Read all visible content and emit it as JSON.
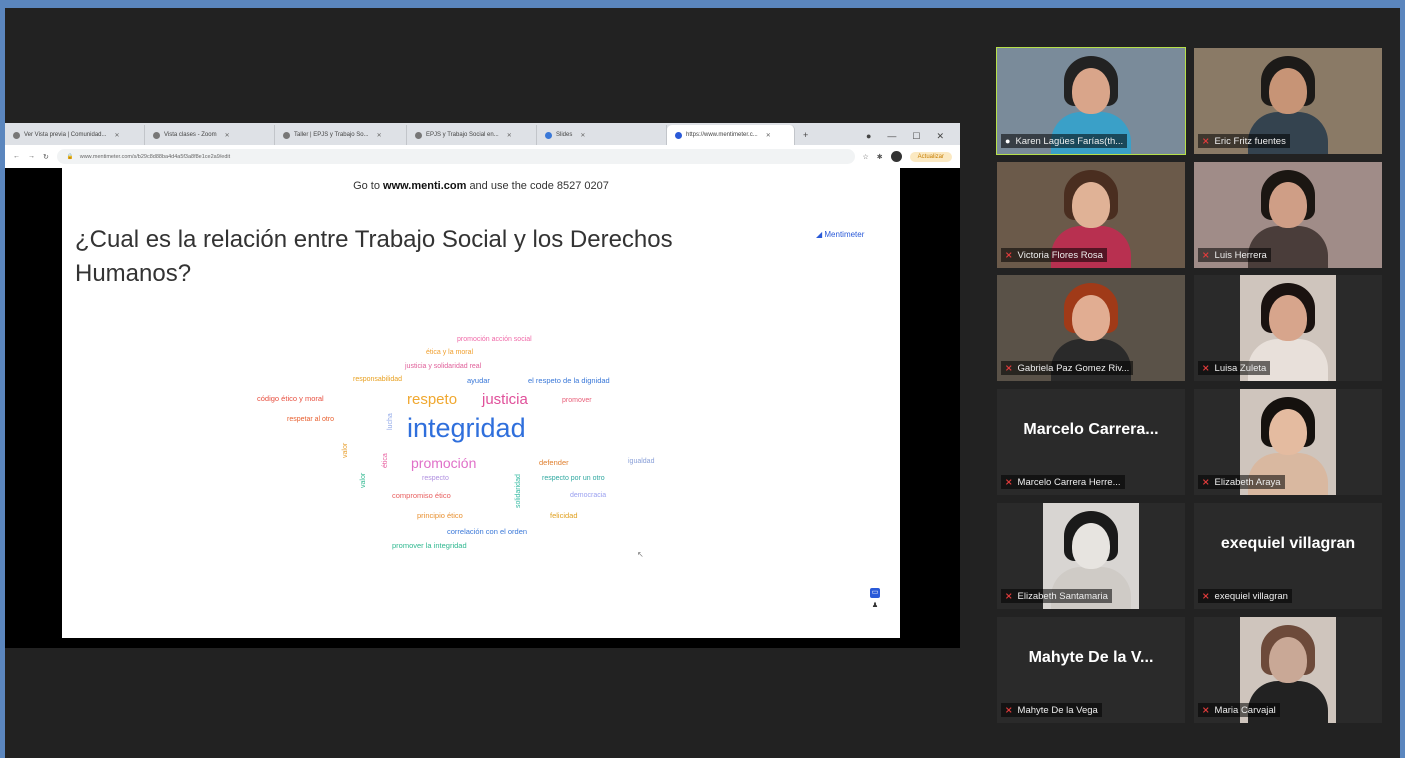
{
  "browser": {
    "tabs": [
      {
        "label": "Ver Vista previa | Comunidad..."
      },
      {
        "label": "Vista clases - Zoom"
      },
      {
        "label": "Taller | EPJS y Trabajo So..."
      },
      {
        "label": "EPJS y Trabajo Social en..."
      },
      {
        "label": "Slides"
      },
      {
        "label": "https://www.mentimeter.c..."
      }
    ],
    "url": "www.mentimeter.com/s/b29c8d88ba4d4a5f3a8f8e1ce2a9/edit",
    "update_label": "Actualizar"
  },
  "slide": {
    "goto_prefix": "Go to",
    "goto_site": "www.menti.com",
    "goto_middle": "and use the code",
    "goto_code": "8527 0207",
    "question": "¿Cual es la relación entre Trabajo Social y los Derechos Humanos?",
    "logo": "Mentimeter"
  },
  "wordcloud": [
    {
      "text": "promoción acción social",
      "color": "#f06aa8"
    },
    {
      "text": "ética y la moral",
      "color": "#f0a030"
    },
    {
      "text": "justicia y solidaridad real",
      "color": "#e0609a"
    },
    {
      "text": "responsabilidad",
      "color": "#e8a020"
    },
    {
      "text": "ayudar",
      "color": "#3a78d8"
    },
    {
      "text": "el respeto de la dignidad",
      "color": "#3a78d8"
    },
    {
      "text": "código ético y moral",
      "color": "#e85040"
    },
    {
      "text": "respeto",
      "color": "#f0a830"
    },
    {
      "text": "justicia",
      "color": "#e0509a"
    },
    {
      "text": "promover",
      "color": "#e8607a"
    },
    {
      "text": "respetar al otro",
      "color": "#e86030"
    },
    {
      "text": "integridad",
      "color": "#2f6fdc"
    },
    {
      "text": "promoción",
      "color": "#e070c8"
    },
    {
      "text": "defender",
      "color": "#e08030"
    },
    {
      "text": "igualdad",
      "color": "#8aa0d8"
    },
    {
      "text": "respecto",
      "color": "#b090e0"
    },
    {
      "text": "respecto por un otro",
      "color": "#30a8a0"
    },
    {
      "text": "compromiso ético",
      "color": "#e86060"
    },
    {
      "text": "democracia",
      "color": "#9aa0f0"
    },
    {
      "text": "principio ético",
      "color": "#e89030"
    },
    {
      "text": "felicidad",
      "color": "#e0a020"
    },
    {
      "text": "correlación con el orden",
      "color": "#3a78d8"
    },
    {
      "text": "promover la integridad",
      "color": "#30b890"
    },
    {
      "text": "lucha",
      "color": "#90a8e8"
    },
    {
      "text": "ética",
      "color": "#e860a0"
    },
    {
      "text": "valor",
      "color": "#30b890"
    },
    {
      "text": "valor",
      "color": "#e8a030"
    },
    {
      "text": "solidaridad",
      "color": "#30b8a0"
    }
  ],
  "participants": [
    {
      "name": "Karen Lagües Farías(th...",
      "mic": "on",
      "display": ""
    },
    {
      "name": "Eric Fritz fuentes",
      "mic": "off",
      "display": ""
    },
    {
      "name": "Victoria Flores Rosa",
      "mic": "off",
      "display": ""
    },
    {
      "name": "Luis Herrera",
      "mic": "off",
      "display": ""
    },
    {
      "name": "Gabriela Paz Gomez Riv...",
      "mic": "off",
      "display": ""
    },
    {
      "name": "Luisa Zuleta",
      "mic": "off",
      "display": ""
    },
    {
      "name": "Marcelo Carrera Herre...",
      "mic": "off",
      "display": "Marcelo  Carrera..."
    },
    {
      "name": "Elizabeth Araya",
      "mic": "off",
      "display": ""
    },
    {
      "name": "Elizabeth Santamaria",
      "mic": "off",
      "display": ""
    },
    {
      "name": "exequiel villagran",
      "mic": "off",
      "display": "exequiel villagran"
    },
    {
      "name": "Mahyte De la Vega",
      "mic": "off",
      "display": "Mahyte De la V..."
    },
    {
      "name": "Maria Carvajal",
      "mic": "off",
      "display": ""
    }
  ]
}
